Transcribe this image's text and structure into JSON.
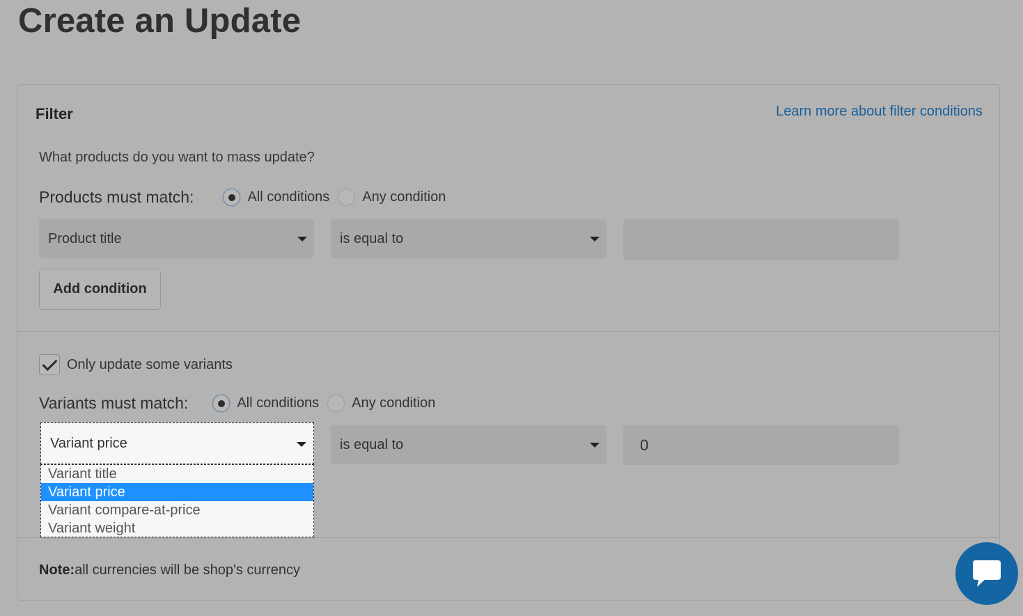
{
  "page_title": "Create an Update",
  "filter": {
    "title": "Filter",
    "learn_more_link": "Learn more about filter conditions",
    "question": "What products do you want to mass update?",
    "products_match": {
      "label": "Products must match:",
      "options": [
        "All conditions",
        "Any condition"
      ],
      "selected": "All conditions"
    },
    "product_condition": {
      "field": "Product title",
      "operator": "is equal to",
      "value": ""
    },
    "add_condition_label": "Add condition",
    "only_update_variants": {
      "label": "Only update some variants",
      "checked": true
    },
    "variants_match": {
      "label": "Variants must match:",
      "options": [
        "All conditions",
        "Any condition"
      ],
      "selected": "All conditions"
    },
    "variant_condition": {
      "field": "Variant price",
      "operator": "is equal to",
      "value": "0"
    },
    "variant_field_options": [
      "Variant title",
      "Variant price",
      "Variant compare-at-price",
      "Variant weight"
    ],
    "variant_field_selected": "Variant price",
    "note": {
      "label": "Note:",
      "text": "all currencies will be shop's currency"
    }
  },
  "icons": {
    "chat": "chat-bubble-icon",
    "dropdown": "caret-down-icon",
    "check": "checkmark-icon"
  },
  "colors": {
    "link": "#1a5f99",
    "selected_option": "#1e90ff",
    "chat_button": "#1465a3"
  }
}
